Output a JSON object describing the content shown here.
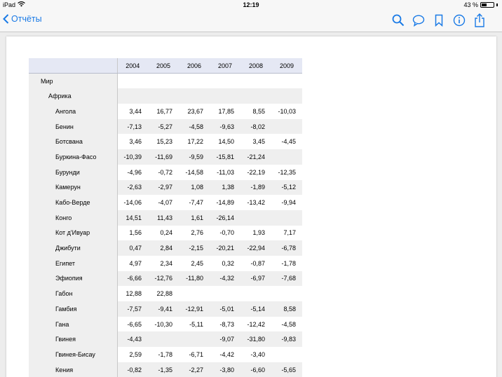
{
  "status_bar": {
    "device": "iPad",
    "time": "12:19",
    "battery_percent": "43 %",
    "battery_level": 0.43,
    "wifi_icon": "wifi-icon"
  },
  "nav": {
    "back_label": "Отчёты",
    "icons": [
      "search-icon",
      "comment-icon",
      "bookmark-icon",
      "info-icon",
      "share-icon"
    ],
    "accent_color": "#1a7ae6"
  },
  "table": {
    "years": [
      "2004",
      "2005",
      "2006",
      "2007",
      "2008",
      "2009"
    ],
    "rows": [
      {
        "label": "Мир",
        "level": 0,
        "values": [
          "",
          "",
          "",
          "",
          "",
          ""
        ]
      },
      {
        "label": "Африка",
        "level": 1,
        "values": [
          "",
          "",
          "",
          "",
          "",
          ""
        ]
      },
      {
        "label": "Ангола",
        "level": 2,
        "values": [
          "3,44",
          "16,77",
          "23,67",
          "17,85",
          "8,55",
          "-10,03"
        ]
      },
      {
        "label": "Бенин",
        "level": 2,
        "values": [
          "-7,13",
          "-5,27",
          "-4,58",
          "-9,63",
          "-8,02",
          ""
        ]
      },
      {
        "label": "Ботсвана",
        "level": 2,
        "values": [
          "3,46",
          "15,23",
          "17,22",
          "14,50",
          "3,45",
          "-4,45"
        ]
      },
      {
        "label": "Буркина-Фасо",
        "level": 2,
        "values": [
          "-10,39",
          "-11,69",
          "-9,59",
          "-15,81",
          "-21,24",
          ""
        ]
      },
      {
        "label": "Бурунди",
        "level": 2,
        "values": [
          "-4,96",
          "-0,72",
          "-14,58",
          "-11,03",
          "-22,19",
          "-12,35"
        ]
      },
      {
        "label": "Камерун",
        "level": 2,
        "values": [
          "-2,63",
          "-2,97",
          "1,08",
          "1,38",
          "-1,89",
          "-5,12"
        ]
      },
      {
        "label": "Кабо-Верде",
        "level": 2,
        "values": [
          "-14,06",
          "-4,07",
          "-7,47",
          "-14,89",
          "-13,42",
          "-9,94"
        ]
      },
      {
        "label": "Конго",
        "level": 2,
        "values": [
          "14,51",
          "11,43",
          "1,61",
          "-26,14",
          "",
          ""
        ]
      },
      {
        "label": "Кот д'Ивуар",
        "level": 2,
        "values": [
          "1,56",
          "0,24",
          "2,76",
          "-0,70",
          "1,93",
          "7,17"
        ]
      },
      {
        "label": "Джибути",
        "level": 2,
        "values": [
          "0,47",
          "2,84",
          "-2,15",
          "-20,21",
          "-22,94",
          "-6,78"
        ]
      },
      {
        "label": "Египет",
        "level": 2,
        "values": [
          "4,97",
          "2,34",
          "2,45",
          "0,32",
          "-0,87",
          "-1,78"
        ]
      },
      {
        "label": "Эфиопия",
        "level": 2,
        "values": [
          "-6,66",
          "-12,76",
          "-11,80",
          "-4,32",
          "-6,97",
          "-7,68"
        ]
      },
      {
        "label": "Габон",
        "level": 2,
        "values": [
          "12,88",
          "22,88",
          "",
          "",
          "",
          ""
        ]
      },
      {
        "label": "Гамбия",
        "level": 2,
        "values": [
          "-7,57",
          "-9,41",
          "-12,91",
          "-5,01",
          "-5,14",
          "8,58"
        ]
      },
      {
        "label": "Гана",
        "level": 2,
        "values": [
          "-6,65",
          "-10,30",
          "-5,11",
          "-8,73",
          "-12,42",
          "-4,58"
        ]
      },
      {
        "label": "Гвинея",
        "level": 2,
        "values": [
          "-4,43",
          "",
          "",
          "-9,07",
          "-31,80",
          "-9,83"
        ]
      },
      {
        "label": "Гвинея-Бисау",
        "level": 2,
        "values": [
          "2,59",
          "-1,78",
          "-6,71",
          "-4,42",
          "-3,40",
          ""
        ]
      },
      {
        "label": "Кения",
        "level": 2,
        "values": [
          "-0,82",
          "-1,35",
          "-2,27",
          "-3,80",
          "-6,60",
          "-5,65"
        ]
      }
    ]
  }
}
